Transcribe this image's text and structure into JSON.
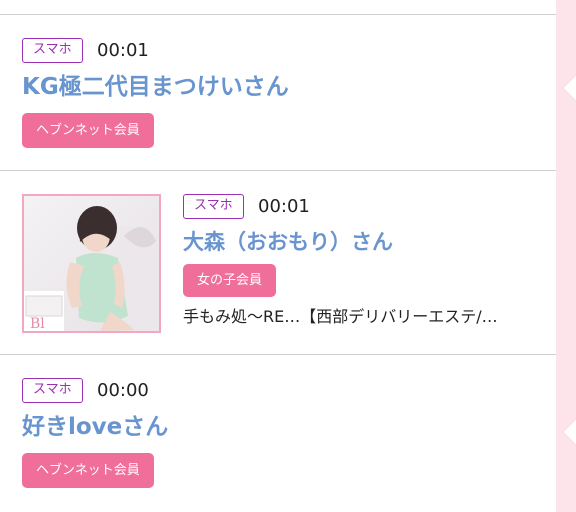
{
  "entries": [
    {
      "device": "スマホ",
      "time": "00:01",
      "name": "KG極二代目まつけいさん",
      "member_label": "ヘブンネット会員"
    },
    {
      "device": "スマホ",
      "time": "00:01",
      "name": "大森（おおもり）さん",
      "member_label": "女の子会員",
      "shop_text": "手もみ処〜RE…【西部デリバリーエステ/…",
      "photo_icon": "girl-photo-thumbnail"
    },
    {
      "device": "スマホ",
      "time": "00:00",
      "name": "好きloveさん",
      "member_label": "ヘブンネット会員"
    }
  ],
  "colors": {
    "badge_purple": "#9c2fb4",
    "name_blue": "#6894cf",
    "button_pink": "#f06e9a",
    "side_pink": "#fde4ea"
  }
}
